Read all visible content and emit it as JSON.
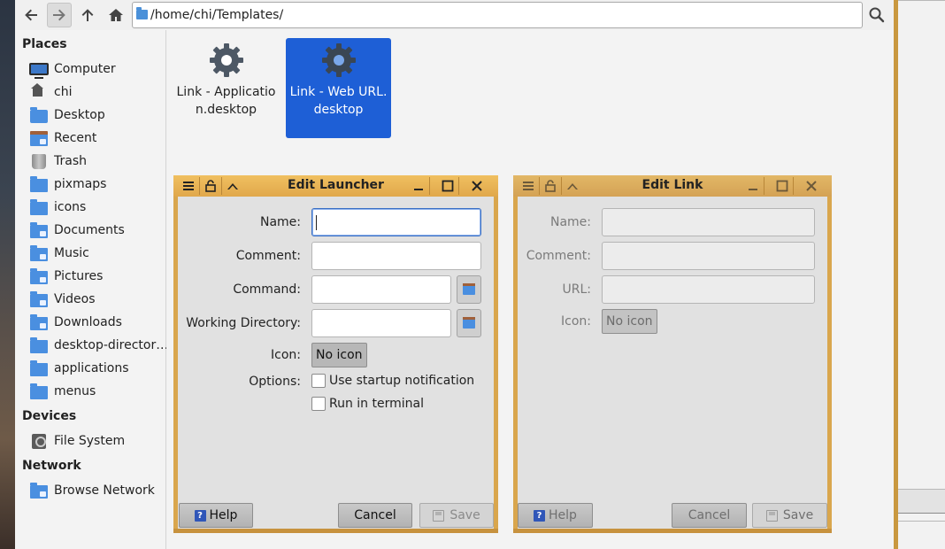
{
  "toolbar": {
    "location": "/home/chi/Templates/"
  },
  "sidebar": {
    "places_header": "Places",
    "devices_header": "Devices",
    "network_header": "Network",
    "places": [
      {
        "label": "Computer",
        "icon": "monitor-icon"
      },
      {
        "label": "chi",
        "icon": "home-icon"
      },
      {
        "label": "Desktop",
        "icon": "desktop-icon"
      },
      {
        "label": "Recent",
        "icon": "recent-folder-icon"
      },
      {
        "label": "Trash",
        "icon": "trash-icon"
      },
      {
        "label": "pixmaps",
        "icon": "folder-icon"
      },
      {
        "label": "icons",
        "icon": "folder-icon"
      },
      {
        "label": "Documents",
        "icon": "documents-folder-icon"
      },
      {
        "label": "Music",
        "icon": "music-folder-icon"
      },
      {
        "label": "Pictures",
        "icon": "pictures-folder-icon"
      },
      {
        "label": "Videos",
        "icon": "videos-folder-icon"
      },
      {
        "label": "Downloads",
        "icon": "downloads-folder-icon"
      },
      {
        "label": "desktop-director…",
        "icon": "folder-icon"
      },
      {
        "label": "applications",
        "icon": "folder-icon"
      },
      {
        "label": "menus",
        "icon": "folder-icon"
      }
    ],
    "devices": [
      {
        "label": "File System",
        "icon": "drive-icon"
      }
    ],
    "network": [
      {
        "label": "Browse Network",
        "icon": "network-folder-icon"
      }
    ]
  },
  "files": [
    {
      "name": "Link - Application.desktop",
      "selected": false
    },
    {
      "name": "Link - Web URL.desktop",
      "selected": true
    }
  ],
  "edit_launcher": {
    "title": "Edit Launcher",
    "name_label": "Name:",
    "name_value": "",
    "comment_label": "Comment:",
    "command_label": "Command:",
    "workdir_label": "Working Directory:",
    "icon_label": "Icon:",
    "icon_button": "No icon",
    "options_label": "Options:",
    "opt_startup": "Use startup notification",
    "opt_terminal": "Run in terminal",
    "help": "Help",
    "cancel": "Cancel",
    "save": "Save"
  },
  "edit_link": {
    "title": "Edit Link",
    "name_label": "Name:",
    "comment_label": "Comment:",
    "url_label": "URL:",
    "icon_label": "Icon:",
    "icon_button": "No icon",
    "help": "Help",
    "cancel": "Cancel",
    "save": "Save"
  },
  "colors": {
    "selection": "#1e5fd6",
    "dialog_frame": "#d9a64d",
    "folder": "#4a8fe0"
  }
}
